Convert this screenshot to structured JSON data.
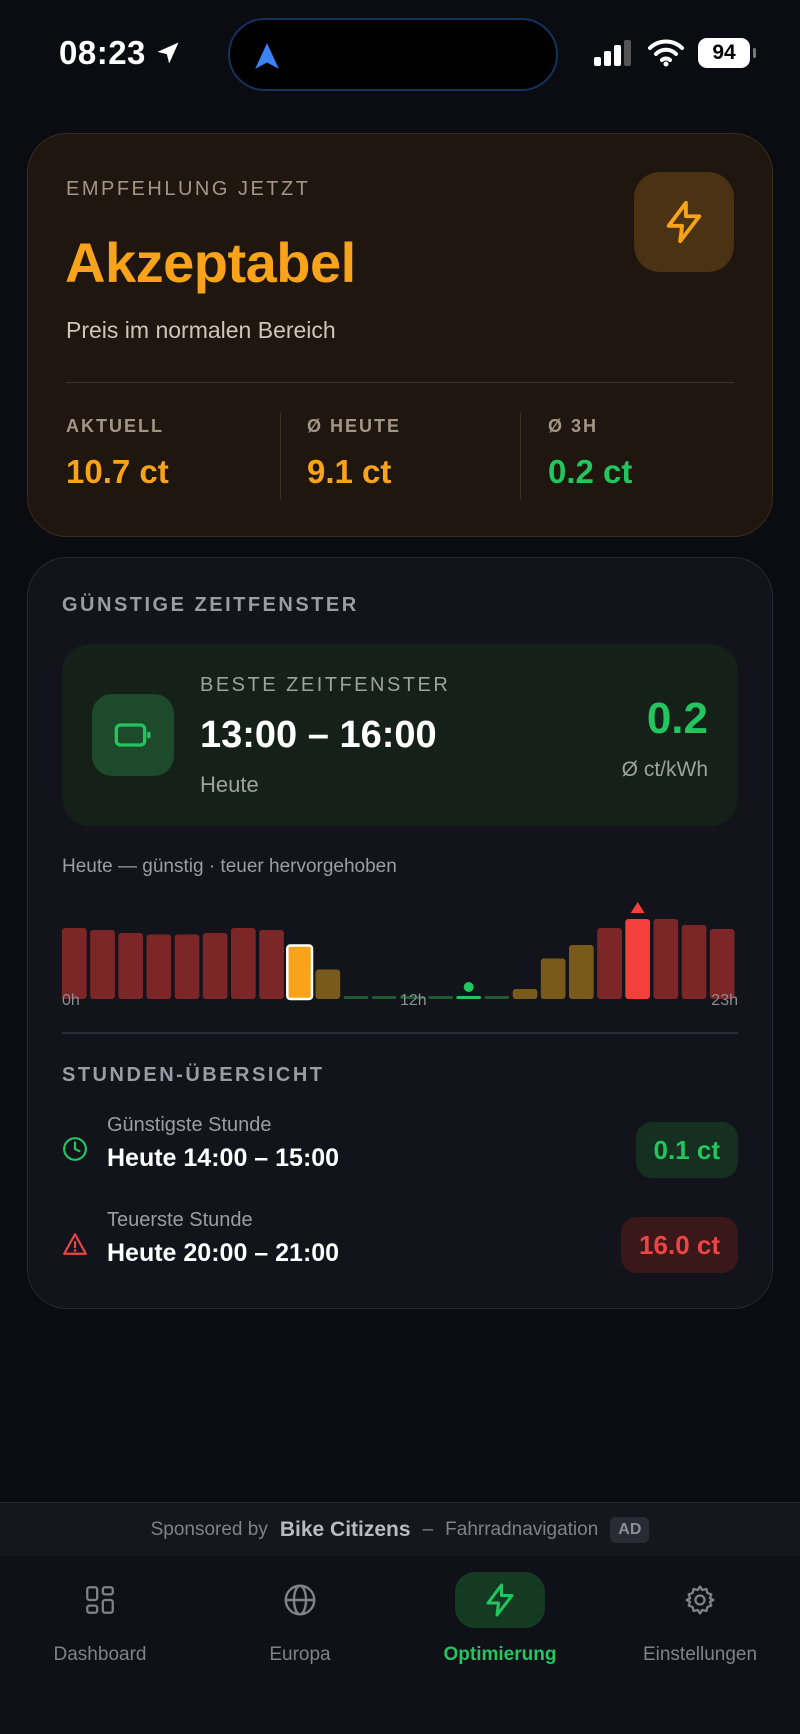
{
  "status_bar": {
    "time": "08:23",
    "battery": "94"
  },
  "recommendation": {
    "label": "EMPFEHLUNG JETZT",
    "headline": "Akzeptabel",
    "subtitle": "Preis im normalen Bereich",
    "accent_color": "#f9a31b",
    "stats": [
      {
        "label": "AKTUELL",
        "value": "10.7 ct",
        "color": "#f9a31b"
      },
      {
        "label": "Ø HEUTE",
        "value": "9.1 ct",
        "color": "#f9a31b"
      },
      {
        "label": "Ø 3H",
        "value": "0.2 ct",
        "color": "#22c55e"
      }
    ]
  },
  "windows": {
    "section_title": "GÜNSTIGE ZEITFENSTER",
    "best": {
      "label": "BESTE ZEITFENSTER",
      "time": "13:00 – 16:00",
      "day": "Heute",
      "value": "0.2",
      "unit": "Ø ct/kWh"
    },
    "chart_caption": "Heute — günstig · teuer hervorgehoben",
    "axis_labels": {
      "start": "0h",
      "mid": "12h",
      "end": "23h"
    },
    "hours_title": "STUNDEN-ÜBERSICHT",
    "cheapest": {
      "label": "Günstigste Stunde",
      "time": "Heute 14:00 – 15:00",
      "value": "0.1 ct"
    },
    "most_expensive": {
      "label": "Teuerste Stunde",
      "time": "Heute 20:00 – 21:00",
      "value": "16.0 ct"
    }
  },
  "chart_data": {
    "type": "bar",
    "x": [
      0,
      1,
      2,
      3,
      4,
      5,
      6,
      7,
      8,
      9,
      10,
      11,
      12,
      13,
      14,
      15,
      16,
      17,
      18,
      19,
      20,
      21,
      22,
      23
    ],
    "values": [
      14.2,
      13.8,
      13.2,
      12.9,
      12.9,
      13.2,
      14.2,
      13.8,
      10.7,
      5.9,
      0.6,
      0.4,
      0.4,
      0.5,
      0.1,
      0.4,
      2.0,
      8.1,
      10.8,
      14.2,
      16.0,
      16.0,
      14.8,
      14.0
    ],
    "current_hour": 8,
    "cheapest_hour": 14,
    "most_expensive_hour": 20,
    "colors": {
      "expensive": "#7d2628",
      "peak": "#f43f3a",
      "mid": "#7a5a1a",
      "cheap": "#1f5a30",
      "cheapest": "#22c55e",
      "current": "#f9a31b"
    },
    "xlabel": "",
    "ylabel": ""
  },
  "sponsor": {
    "prefix": "Sponsored by",
    "brand": "Bike Citizens",
    "separator": "–",
    "tagline": "Fahrradnavigation",
    "badge": "AD"
  },
  "tabs": [
    {
      "label": "Dashboard",
      "icon": "dashboard-icon",
      "active": false
    },
    {
      "label": "Europa",
      "icon": "globe-icon",
      "active": false
    },
    {
      "label": "Optimierung",
      "icon": "bolt-icon",
      "active": true
    },
    {
      "label": "Einstellungen",
      "icon": "gear-icon",
      "active": false
    }
  ]
}
